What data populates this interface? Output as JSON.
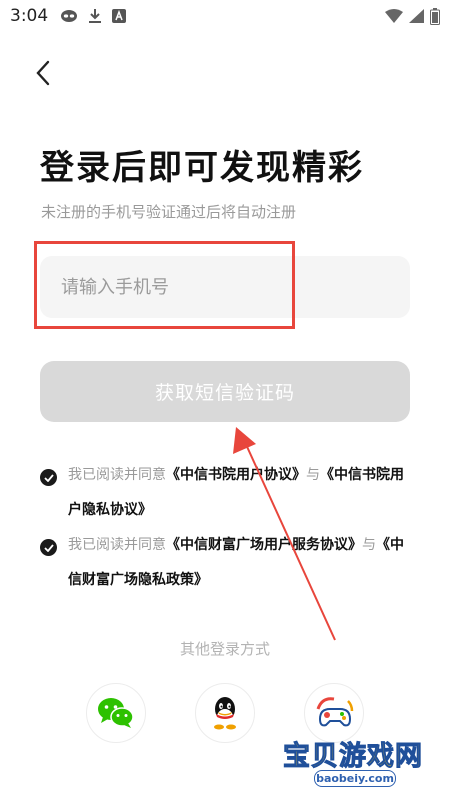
{
  "status_bar": {
    "time": "3:04",
    "icons_left": [
      "eye-mask-icon",
      "download-icon",
      "a-letter-icon"
    ],
    "icons_right": [
      "wifi-icon",
      "signal-icon",
      "battery-icon"
    ]
  },
  "nav": {
    "back_icon": "chevron-left-icon"
  },
  "header": {
    "title": "登录后即可发现精彩",
    "subtitle": "未注册的手机号验证通过后将自动注册"
  },
  "form": {
    "phone_placeholder": "请输入手机号",
    "phone_value": "",
    "get_code_label": "获取短信验证码"
  },
  "agreements": [
    {
      "checked": true,
      "prefix": "我已阅读并同意",
      "link1": "《中信书院用户协议》",
      "joiner": "与",
      "link2": "《中信书院用户隐私协议》"
    },
    {
      "checked": true,
      "prefix": "我已阅读并同意",
      "link1": "《中信财富广场用户服务协议》",
      "joiner": "与",
      "link2": "《中信财富广场隐私政策》"
    }
  ],
  "other_login": {
    "label": "其他登录方式",
    "methods": [
      "wechat-icon",
      "qq-icon",
      "gamepad-icon"
    ]
  },
  "watermark": {
    "title": "宝贝游戏网",
    "url": "baobeiy.com"
  },
  "colors": {
    "accent_red": "#e8463c",
    "button_disabled": "#d9d9d9",
    "input_bg": "#f5f5f5",
    "wechat_green": "#2dc100",
    "text_primary": "#111111",
    "text_secondary": "#9a9a9a"
  }
}
